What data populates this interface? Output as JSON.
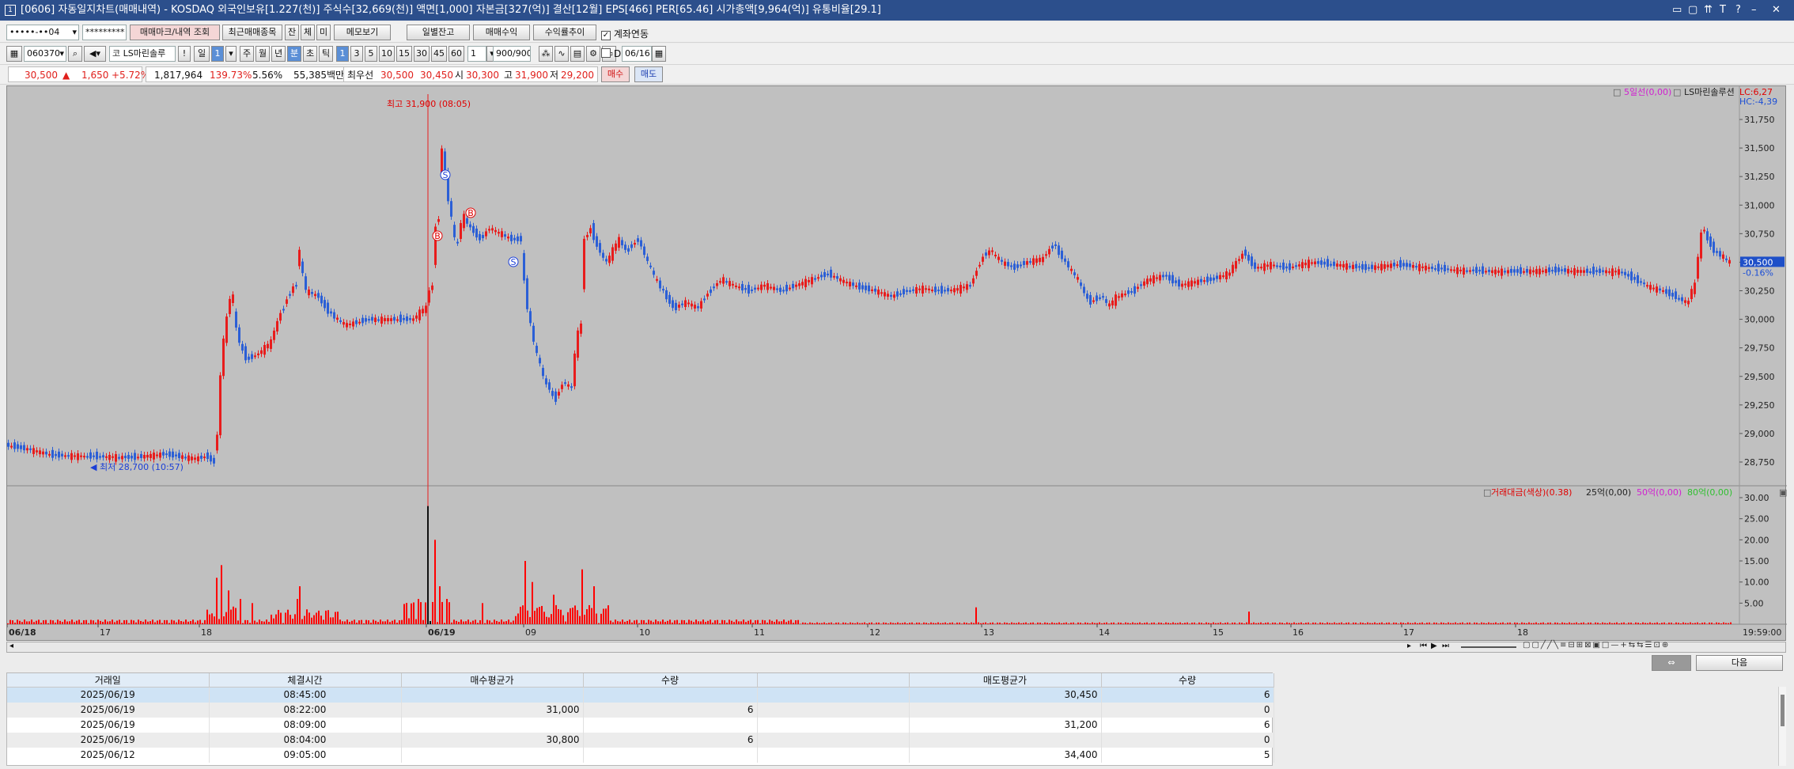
{
  "window": {
    "icon": "window-icon",
    "title": "[0606] 자동일지차트(매매내역) - KOSDAQ 외국인보유[1.227(천)] 주식수[32,669(천)] 액면[1,000] 자본금[327(억)] 결산[12월] EPS[466] PER[65.46] 시가총액[9,964(억)] 유통비율[29.1]",
    "controls": [
      "▭",
      "▢",
      "⇈",
      "T",
      "?",
      "–",
      "✕"
    ]
  },
  "row1": {
    "account": "•••••-••04",
    "password": "*********",
    "btn_trade_query": "매매마크/내역 조회",
    "btn_recent": "최근매매종목",
    "btn_jan": "잔",
    "btn_che": "체",
    "btn_mi": "미",
    "btn_memo": "메모보기",
    "btn_daily": "일별잔고",
    "btn_pnl": "매매수익",
    "btn_yield": "수익률추이",
    "chk_link": "계좌연동"
  },
  "row2": {
    "code": "060370",
    "stock_name": "LS마린솔루",
    "bang": "!",
    "il": "일",
    "one": "1",
    "ju": "주",
    "wol": "월",
    "nyeon": "년",
    "bun": "분",
    "cho": "초",
    "tik": "틱",
    "periods": [
      "1",
      "3",
      "5",
      "10",
      "15",
      "30",
      "45",
      "60"
    ],
    "n": "1",
    "count": "900/900",
    "d_label": "D",
    "date": "06/16"
  },
  "quote": {
    "price": "30,500",
    "arrow": "▲",
    "change": "1,650",
    "rate": "+5.72%",
    "volume": "1,817,964",
    "vol_ratio": "139.73%",
    "turnover": "5.56%",
    "amount": "55,385백만",
    "best_label": "최우선",
    "ask": "30,500",
    "bid": "30,450",
    "open_l": "시",
    "open": "30,300",
    "high_l": "고",
    "high": "31,900",
    "low_l": "저",
    "low": "29,200",
    "buy": "매수",
    "sell": "매도"
  },
  "chart": {
    "legend_ma": "5일선(0,00)",
    "legend_name": "LS마린솔루션",
    "lc": "LC:6,27",
    "hc": "HC:-4,39",
    "price_ticks": [
      "31,750",
      "31,500",
      "31,250",
      "31,000",
      "30,750",
      "30,500",
      "30,250",
      "30,000",
      "29,750",
      "29,500",
      "29,250",
      "29,000",
      "28,750"
    ],
    "current_price": "30,500",
    "current_pct": "-0.16%",
    "high_note": "최고 31,900 (08:05)",
    "low_note": "최저 28,700 (10:57)",
    "buy_marker": "B",
    "sell_marker": "S",
    "vol_legend": [
      "거래대금(색상)(0.38)",
      "25억(0,00)",
      "50억(0,00)",
      "80억(0,00)"
    ],
    "vol_ticks": [
      "30.00",
      "25.00",
      "20.00",
      "15.00",
      "10.00",
      "5.00"
    ],
    "date_labels": [
      "06/18",
      "17",
      "18",
      "06/19",
      "09",
      "10",
      "11",
      "12",
      "13",
      "14",
      "15",
      "16",
      "17",
      "18"
    ],
    "time_label": "19:59:00",
    "colors": {
      "up": "#e81c1c",
      "down": "#2b5fd6",
      "bg": "#c0c0c0",
      "vol": "#ff0000"
    }
  },
  "bottom": {
    "next": "다음"
  },
  "grid": {
    "headers": [
      "거래일",
      "체결시간",
      "매수평균가",
      "수량",
      "",
      "매도평균가",
      "수량"
    ],
    "rows": [
      [
        "2025/06/19",
        "08:45:00",
        "",
        "",
        "",
        "30,450",
        "6"
      ],
      [
        "2025/06/19",
        "08:22:00",
        "31,000",
        "6",
        "",
        "",
        "0"
      ],
      [
        "2025/06/19",
        "08:09:00",
        "",
        "",
        "",
        "31,200",
        "6"
      ],
      [
        "2025/06/19",
        "08:04:00",
        "30,800",
        "6",
        "",
        "",
        "0"
      ],
      [
        "2025/06/12",
        "09:05:00",
        "",
        "",
        "",
        "34,400",
        "5"
      ]
    ]
  }
}
